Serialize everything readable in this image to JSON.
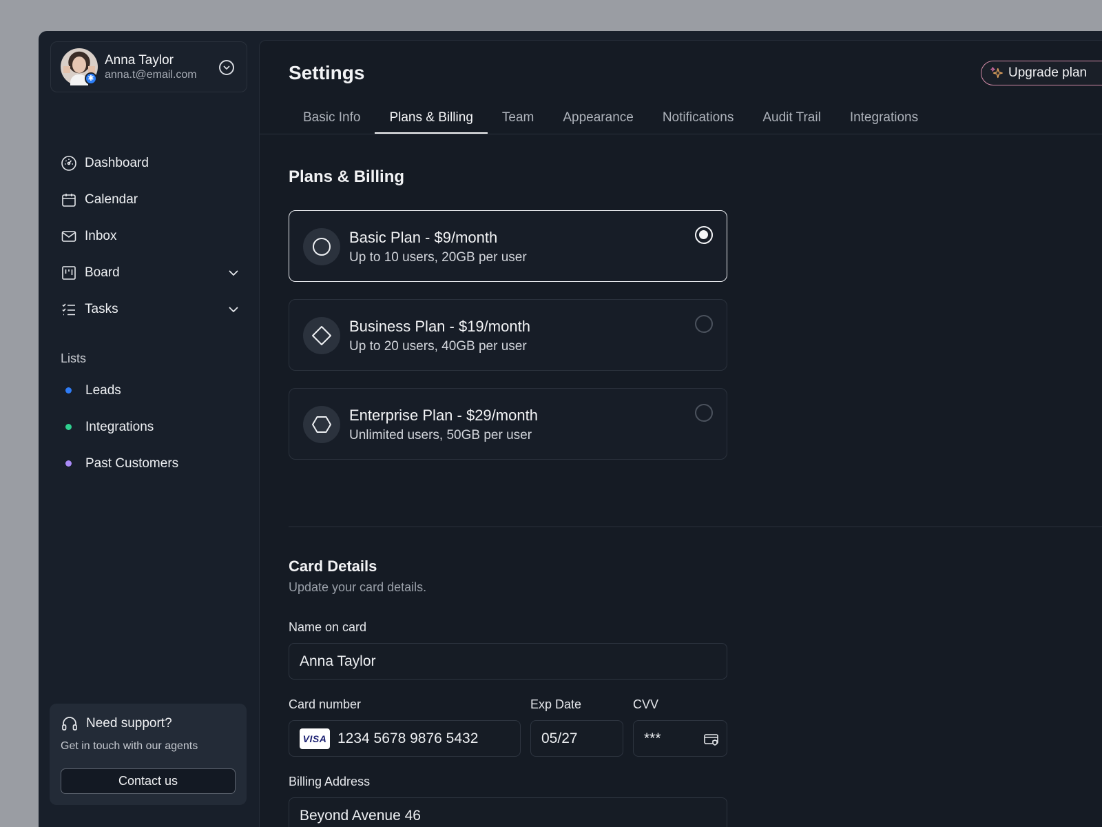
{
  "user": {
    "name": "Anna Taylor",
    "email": "anna.t@email.com"
  },
  "sidebar": {
    "nav": [
      {
        "label": "Dashboard",
        "icon": "dashboard-icon"
      },
      {
        "label": "Calendar",
        "icon": "calendar-icon"
      },
      {
        "label": "Inbox",
        "icon": "inbox-icon"
      },
      {
        "label": "Board",
        "icon": "board-icon",
        "expandable": true
      },
      {
        "label": "Tasks",
        "icon": "tasks-icon",
        "expandable": true
      }
    ],
    "lists_title": "Lists",
    "lists": [
      {
        "label": "Leads",
        "color": "#2f7cf6"
      },
      {
        "label": "Integrations",
        "color": "#2fcf8f"
      },
      {
        "label": "Past Customers",
        "color": "#a98af7"
      }
    ],
    "support": {
      "title": "Need support?",
      "text": "Get in touch with our agents",
      "button": "Contact us"
    }
  },
  "main": {
    "title": "Settings",
    "upgrade_label": "Upgrade plan",
    "tabs": [
      {
        "label": "Basic Info",
        "active": false
      },
      {
        "label": "Plans & Billing",
        "active": true
      },
      {
        "label": "Team",
        "active": false
      },
      {
        "label": "Appearance",
        "active": false
      },
      {
        "label": "Notifications",
        "active": false
      },
      {
        "label": "Audit Trail",
        "active": false
      },
      {
        "label": "Integrations",
        "active": false
      }
    ],
    "section_title": "Plans & Billing",
    "plans": [
      {
        "name": "Basic Plan - $9/month",
        "desc": "Up to 10 users, 20GB per user",
        "icon": "circle-icon",
        "selected": true
      },
      {
        "name": "Business Plan - $19/month",
        "desc": "Up to 20 users, 40GB per user",
        "icon": "diamond-icon",
        "selected": false
      },
      {
        "name": "Enterprise Plan - $29/month",
        "desc": "Unlimited users, 50GB per user",
        "icon": "hexagon-icon",
        "selected": false
      }
    ],
    "card": {
      "title": "Card Details",
      "subtitle": "Update your card details.",
      "name_label": "Name on card",
      "name_value": "Anna Taylor",
      "number_label": "Card number",
      "number_value": "1234 5678 9876 5432",
      "card_brand": "VISA",
      "exp_label": "Exp Date",
      "exp_value": "05/27",
      "cvv_label": "CVV",
      "cvv_value": "***",
      "address_label": "Billing Address",
      "address_value": "Beyond Avenue 46"
    }
  },
  "colors": {
    "background": "#181f2a",
    "panel": "#151b24",
    "accent_border": "#d48ca8"
  }
}
